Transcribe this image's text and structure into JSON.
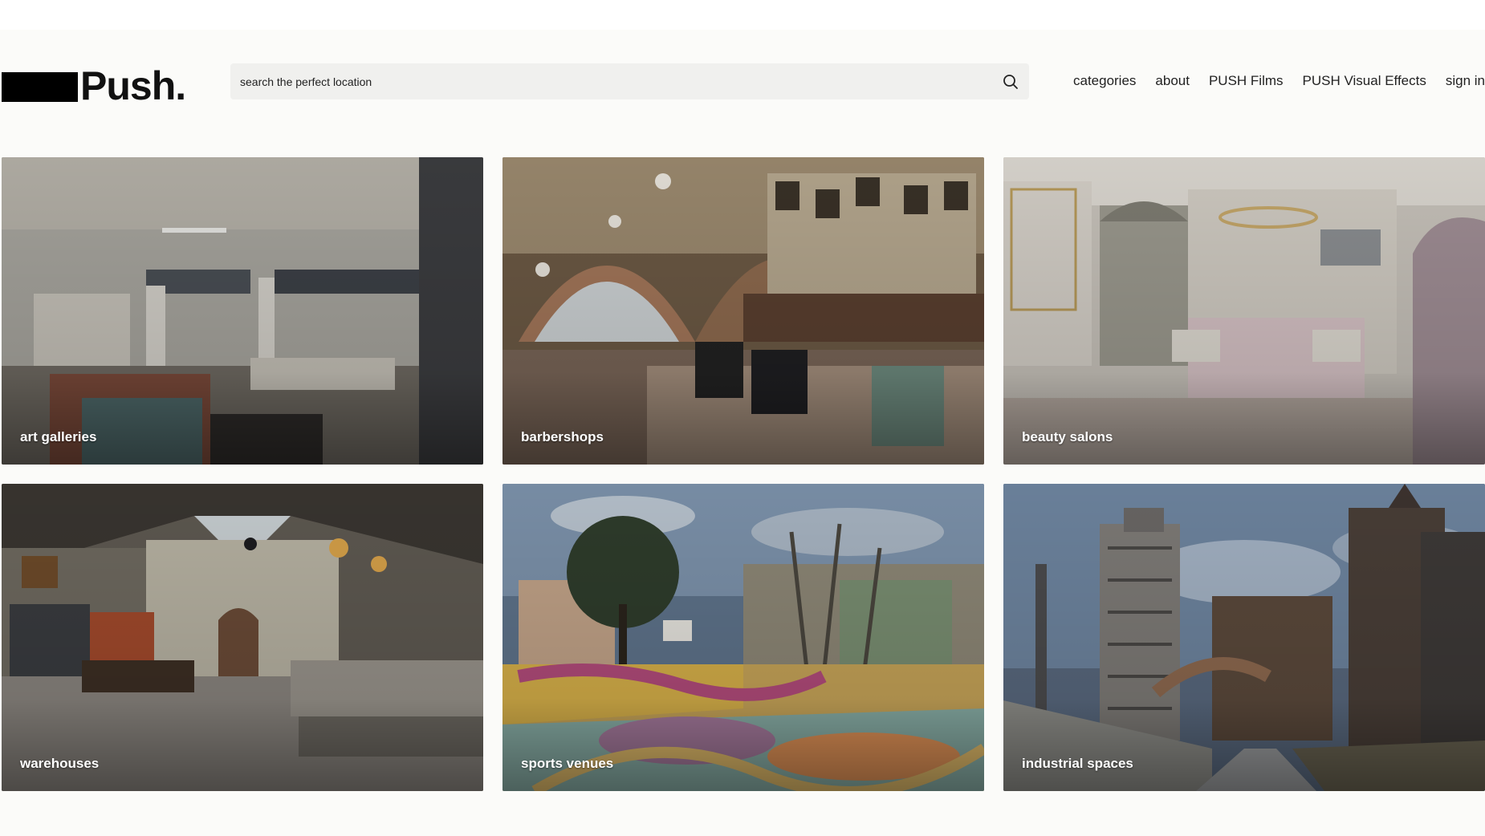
{
  "header": {
    "logo_text": "Push.",
    "search": {
      "placeholder": "search the perfect location",
      "icon": "search-icon"
    },
    "nav": [
      {
        "label": "categories"
      },
      {
        "label": "about"
      },
      {
        "label": "PUSH Films"
      },
      {
        "label": "PUSH Visual Effects"
      },
      {
        "label": "sign in"
      }
    ]
  },
  "categories": [
    {
      "label": "art galleries"
    },
    {
      "label": "barbershops"
    },
    {
      "label": "beauty salons"
    },
    {
      "label": "warehouses"
    },
    {
      "label": "sports venues"
    },
    {
      "label": "industrial spaces"
    }
  ]
}
